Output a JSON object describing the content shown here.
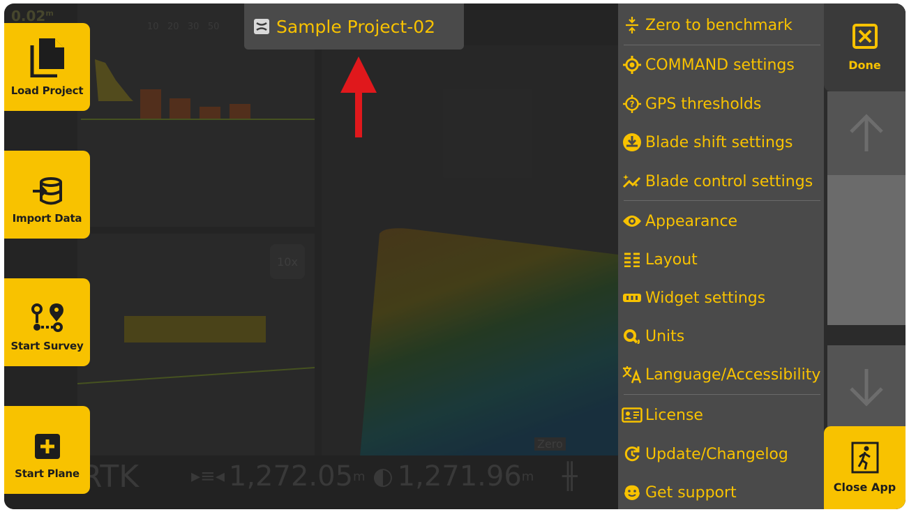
{
  "project": {
    "title": "Sample Project-02"
  },
  "side_buttons": {
    "load": "Load Project",
    "import": "Import Data",
    "survey": "Start Survey",
    "plane": "Start Plane"
  },
  "menu": {
    "items": [
      {
        "label": "Zero to benchmark",
        "icon": "zero-benchmark-icon"
      },
      {
        "label": "COMMAND settings",
        "icon": "crosshair-icon"
      },
      {
        "label": "GPS thresholds",
        "icon": "gps-question-icon"
      },
      {
        "label": "Blade shift settings",
        "icon": "blade-shift-icon"
      },
      {
        "label": "Blade control settings",
        "icon": "sparkle-chart-icon"
      },
      {
        "label": "Appearance",
        "icon": "eye-icon"
      },
      {
        "label": "Layout",
        "icon": "layout-list-icon"
      },
      {
        "label": "Widget settings",
        "icon": "widget-icon"
      },
      {
        "label": "Units",
        "icon": "units-icon"
      },
      {
        "label": "Language/Accessibility",
        "icon": "translate-icon"
      },
      {
        "label": "License",
        "icon": "license-card-icon"
      },
      {
        "label": "Update/Changelog",
        "icon": "update-icon"
      },
      {
        "label": "Get support",
        "icon": "support-icon"
      }
    ]
  },
  "right_panel": {
    "done": "Done",
    "close": "Close App"
  },
  "status_bar": {
    "rtk": "RTK",
    "value1": "1,272.05",
    "unit1": "m",
    "value2": "1,271.96",
    "unit2": "m"
  },
  "background_text": {
    "top_value": "0.02",
    "top_unit": "m",
    "scale_ticks": "10   20   30   50",
    "zoom": "10x",
    "zero": "Zero"
  },
  "colors": {
    "accent": "#f8c200",
    "menu_bg": "#4a4a4a",
    "overlay_bg": "#2f2f2f",
    "arrow": "#e0181c"
  }
}
